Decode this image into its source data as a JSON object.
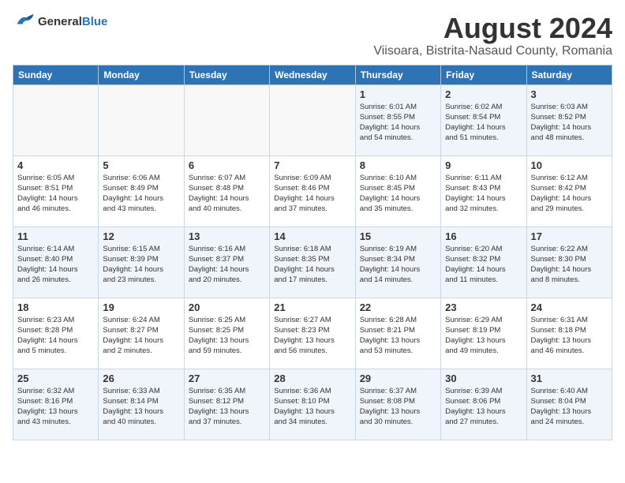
{
  "header": {
    "logo_general": "General",
    "logo_blue": "Blue",
    "month_year": "August 2024",
    "location": "Viisoara, Bistrita-Nasaud County, Romania"
  },
  "weekdays": [
    "Sunday",
    "Monday",
    "Tuesday",
    "Wednesday",
    "Thursday",
    "Friday",
    "Saturday"
  ],
  "weeks": [
    [
      {
        "day": "",
        "detail": ""
      },
      {
        "day": "",
        "detail": ""
      },
      {
        "day": "",
        "detail": ""
      },
      {
        "day": "",
        "detail": ""
      },
      {
        "day": "1",
        "detail": "Sunrise: 6:01 AM\nSunset: 8:55 PM\nDaylight: 14 hours\nand 54 minutes."
      },
      {
        "day": "2",
        "detail": "Sunrise: 6:02 AM\nSunset: 8:54 PM\nDaylight: 14 hours\nand 51 minutes."
      },
      {
        "day": "3",
        "detail": "Sunrise: 6:03 AM\nSunset: 8:52 PM\nDaylight: 14 hours\nand 48 minutes."
      }
    ],
    [
      {
        "day": "4",
        "detail": "Sunrise: 6:05 AM\nSunset: 8:51 PM\nDaylight: 14 hours\nand 46 minutes."
      },
      {
        "day": "5",
        "detail": "Sunrise: 6:06 AM\nSunset: 8:49 PM\nDaylight: 14 hours\nand 43 minutes."
      },
      {
        "day": "6",
        "detail": "Sunrise: 6:07 AM\nSunset: 8:48 PM\nDaylight: 14 hours\nand 40 minutes."
      },
      {
        "day": "7",
        "detail": "Sunrise: 6:09 AM\nSunset: 8:46 PM\nDaylight: 14 hours\nand 37 minutes."
      },
      {
        "day": "8",
        "detail": "Sunrise: 6:10 AM\nSunset: 8:45 PM\nDaylight: 14 hours\nand 35 minutes."
      },
      {
        "day": "9",
        "detail": "Sunrise: 6:11 AM\nSunset: 8:43 PM\nDaylight: 14 hours\nand 32 minutes."
      },
      {
        "day": "10",
        "detail": "Sunrise: 6:12 AM\nSunset: 8:42 PM\nDaylight: 14 hours\nand 29 minutes."
      }
    ],
    [
      {
        "day": "11",
        "detail": "Sunrise: 6:14 AM\nSunset: 8:40 PM\nDaylight: 14 hours\nand 26 minutes."
      },
      {
        "day": "12",
        "detail": "Sunrise: 6:15 AM\nSunset: 8:39 PM\nDaylight: 14 hours\nand 23 minutes."
      },
      {
        "day": "13",
        "detail": "Sunrise: 6:16 AM\nSunset: 8:37 PM\nDaylight: 14 hours\nand 20 minutes."
      },
      {
        "day": "14",
        "detail": "Sunrise: 6:18 AM\nSunset: 8:35 PM\nDaylight: 14 hours\nand 17 minutes."
      },
      {
        "day": "15",
        "detail": "Sunrise: 6:19 AM\nSunset: 8:34 PM\nDaylight: 14 hours\nand 14 minutes."
      },
      {
        "day": "16",
        "detail": "Sunrise: 6:20 AM\nSunset: 8:32 PM\nDaylight: 14 hours\nand 11 minutes."
      },
      {
        "day": "17",
        "detail": "Sunrise: 6:22 AM\nSunset: 8:30 PM\nDaylight: 14 hours\nand 8 minutes."
      }
    ],
    [
      {
        "day": "18",
        "detail": "Sunrise: 6:23 AM\nSunset: 8:28 PM\nDaylight: 14 hours\nand 5 minutes."
      },
      {
        "day": "19",
        "detail": "Sunrise: 6:24 AM\nSunset: 8:27 PM\nDaylight: 14 hours\nand 2 minutes."
      },
      {
        "day": "20",
        "detail": "Sunrise: 6:25 AM\nSunset: 8:25 PM\nDaylight: 13 hours\nand 59 minutes."
      },
      {
        "day": "21",
        "detail": "Sunrise: 6:27 AM\nSunset: 8:23 PM\nDaylight: 13 hours\nand 56 minutes."
      },
      {
        "day": "22",
        "detail": "Sunrise: 6:28 AM\nSunset: 8:21 PM\nDaylight: 13 hours\nand 53 minutes."
      },
      {
        "day": "23",
        "detail": "Sunrise: 6:29 AM\nSunset: 8:19 PM\nDaylight: 13 hours\nand 49 minutes."
      },
      {
        "day": "24",
        "detail": "Sunrise: 6:31 AM\nSunset: 8:18 PM\nDaylight: 13 hours\nand 46 minutes."
      }
    ],
    [
      {
        "day": "25",
        "detail": "Sunrise: 6:32 AM\nSunset: 8:16 PM\nDaylight: 13 hours\nand 43 minutes."
      },
      {
        "day": "26",
        "detail": "Sunrise: 6:33 AM\nSunset: 8:14 PM\nDaylight: 13 hours\nand 40 minutes."
      },
      {
        "day": "27",
        "detail": "Sunrise: 6:35 AM\nSunset: 8:12 PM\nDaylight: 13 hours\nand 37 minutes."
      },
      {
        "day": "28",
        "detail": "Sunrise: 6:36 AM\nSunset: 8:10 PM\nDaylight: 13 hours\nand 34 minutes."
      },
      {
        "day": "29",
        "detail": "Sunrise: 6:37 AM\nSunset: 8:08 PM\nDaylight: 13 hours\nand 30 minutes."
      },
      {
        "day": "30",
        "detail": "Sunrise: 6:39 AM\nSunset: 8:06 PM\nDaylight: 13 hours\nand 27 minutes."
      },
      {
        "day": "31",
        "detail": "Sunrise: 6:40 AM\nSunset: 8:04 PM\nDaylight: 13 hours\nand 24 minutes."
      }
    ]
  ]
}
